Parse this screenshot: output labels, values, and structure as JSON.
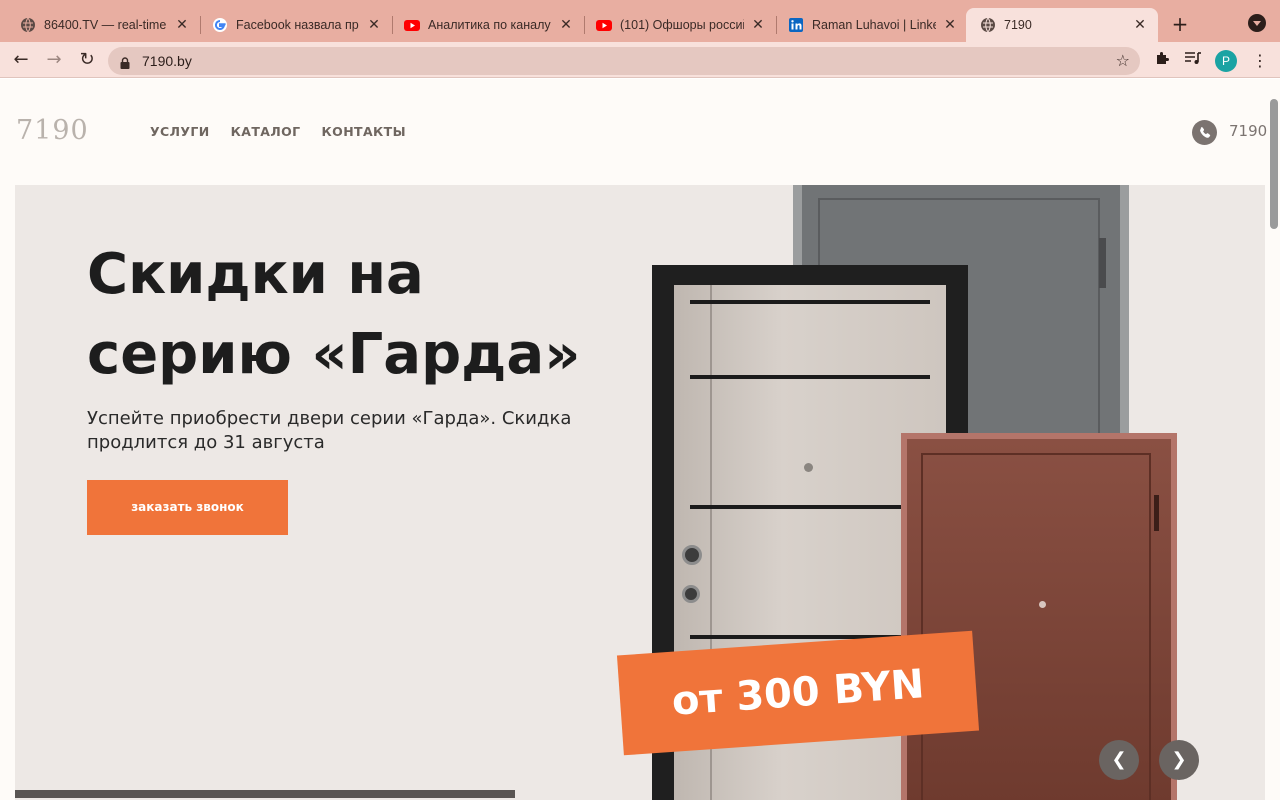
{
  "browser": {
    "tabs": [
      {
        "title": "86400.TV — real-time",
        "favicon": "globe-icon",
        "active": false
      },
      {
        "title": "Facebook назвала пр",
        "favicon": "google-icon",
        "active": false
      },
      {
        "title": "Аналитика по каналу",
        "favicon": "youtube-icon",
        "active": false
      },
      {
        "title": "(101) Офшоры россий",
        "favicon": "youtube-icon",
        "active": false
      },
      {
        "title": "Raman Luhavoi | Linke",
        "favicon": "linkedin-icon",
        "active": false
      },
      {
        "title": "7190",
        "favicon": "globe-icon",
        "active": true
      }
    ],
    "url": "7190.by",
    "profile_initial": "P",
    "colors": {
      "tabstrip": "#e8aea1",
      "toolbar": "#f8e1dc",
      "omnibox": "#e5c8c1"
    }
  },
  "site": {
    "logo": "7190",
    "nav": [
      "УСЛУГИ",
      "КАТАЛОГ",
      "КОНТАКТЫ"
    ],
    "phone": "7190"
  },
  "hero": {
    "title": "Скидки на серию «Гарда»",
    "subtitle": "Успейте приобрести двери серии «Гарда». Скидка продлится до 31 августа",
    "cta": "заказать звонок",
    "price_badge": "от 300 BYN",
    "prev_icon": "chevron-left-icon",
    "next_icon": "chevron-right-icon",
    "slide_progress": 0.4,
    "colors": {
      "accent": "#f0743a",
      "hero_bg": "#ede8e5"
    }
  }
}
